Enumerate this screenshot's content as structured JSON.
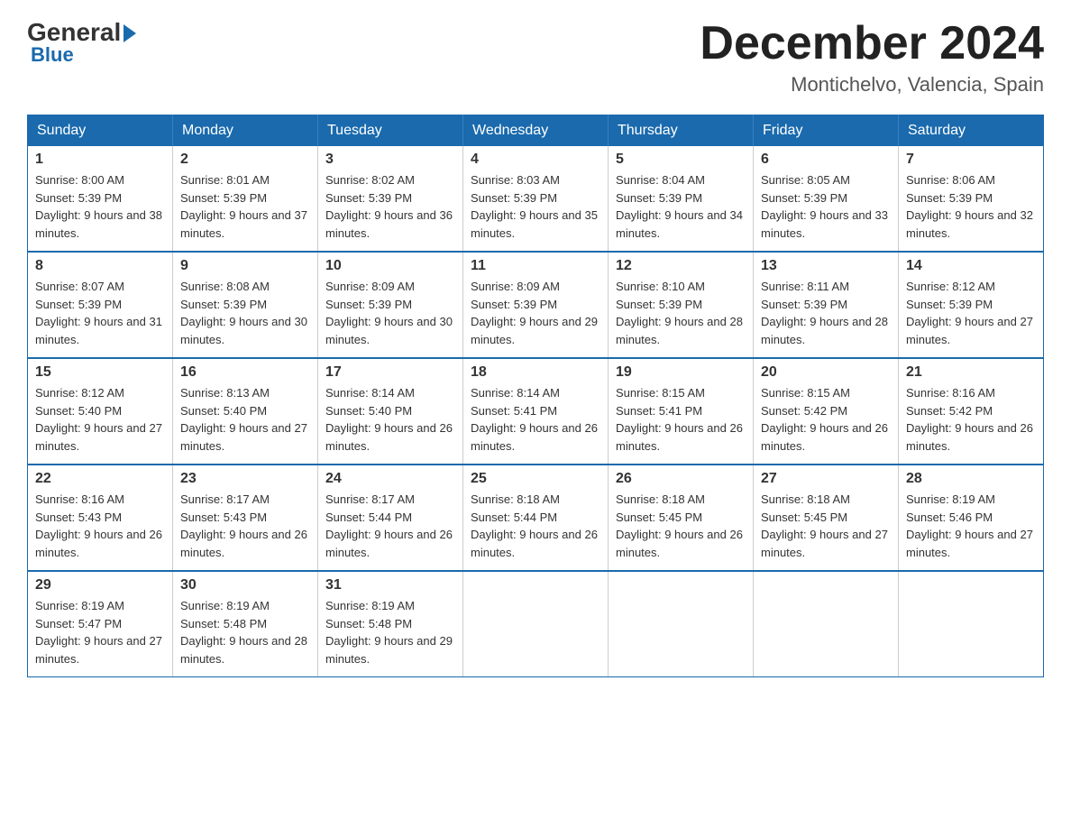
{
  "logo": {
    "general": "General",
    "blue": "Blue"
  },
  "title": {
    "month": "December 2024",
    "location": "Montichelvo, Valencia, Spain"
  },
  "weekdays": [
    "Sunday",
    "Monday",
    "Tuesday",
    "Wednesday",
    "Thursday",
    "Friday",
    "Saturday"
  ],
  "weeks": [
    [
      {
        "day": "1",
        "sunrise": "8:00 AM",
        "sunset": "5:39 PM",
        "daylight": "9 hours and 38 minutes."
      },
      {
        "day": "2",
        "sunrise": "8:01 AM",
        "sunset": "5:39 PM",
        "daylight": "9 hours and 37 minutes."
      },
      {
        "day": "3",
        "sunrise": "8:02 AM",
        "sunset": "5:39 PM",
        "daylight": "9 hours and 36 minutes."
      },
      {
        "day": "4",
        "sunrise": "8:03 AM",
        "sunset": "5:39 PM",
        "daylight": "9 hours and 35 minutes."
      },
      {
        "day": "5",
        "sunrise": "8:04 AM",
        "sunset": "5:39 PM",
        "daylight": "9 hours and 34 minutes."
      },
      {
        "day": "6",
        "sunrise": "8:05 AM",
        "sunset": "5:39 PM",
        "daylight": "9 hours and 33 minutes."
      },
      {
        "day": "7",
        "sunrise": "8:06 AM",
        "sunset": "5:39 PM",
        "daylight": "9 hours and 32 minutes."
      }
    ],
    [
      {
        "day": "8",
        "sunrise": "8:07 AM",
        "sunset": "5:39 PM",
        "daylight": "9 hours and 31 minutes."
      },
      {
        "day": "9",
        "sunrise": "8:08 AM",
        "sunset": "5:39 PM",
        "daylight": "9 hours and 30 minutes."
      },
      {
        "day": "10",
        "sunrise": "8:09 AM",
        "sunset": "5:39 PM",
        "daylight": "9 hours and 30 minutes."
      },
      {
        "day": "11",
        "sunrise": "8:09 AM",
        "sunset": "5:39 PM",
        "daylight": "9 hours and 29 minutes."
      },
      {
        "day": "12",
        "sunrise": "8:10 AM",
        "sunset": "5:39 PM",
        "daylight": "9 hours and 28 minutes."
      },
      {
        "day": "13",
        "sunrise": "8:11 AM",
        "sunset": "5:39 PM",
        "daylight": "9 hours and 28 minutes."
      },
      {
        "day": "14",
        "sunrise": "8:12 AM",
        "sunset": "5:39 PM",
        "daylight": "9 hours and 27 minutes."
      }
    ],
    [
      {
        "day": "15",
        "sunrise": "8:12 AM",
        "sunset": "5:40 PM",
        "daylight": "9 hours and 27 minutes."
      },
      {
        "day": "16",
        "sunrise": "8:13 AM",
        "sunset": "5:40 PM",
        "daylight": "9 hours and 27 minutes."
      },
      {
        "day": "17",
        "sunrise": "8:14 AM",
        "sunset": "5:40 PM",
        "daylight": "9 hours and 26 minutes."
      },
      {
        "day": "18",
        "sunrise": "8:14 AM",
        "sunset": "5:41 PM",
        "daylight": "9 hours and 26 minutes."
      },
      {
        "day": "19",
        "sunrise": "8:15 AM",
        "sunset": "5:41 PM",
        "daylight": "9 hours and 26 minutes."
      },
      {
        "day": "20",
        "sunrise": "8:15 AM",
        "sunset": "5:42 PM",
        "daylight": "9 hours and 26 minutes."
      },
      {
        "day": "21",
        "sunrise": "8:16 AM",
        "sunset": "5:42 PM",
        "daylight": "9 hours and 26 minutes."
      }
    ],
    [
      {
        "day": "22",
        "sunrise": "8:16 AM",
        "sunset": "5:43 PM",
        "daylight": "9 hours and 26 minutes."
      },
      {
        "day": "23",
        "sunrise": "8:17 AM",
        "sunset": "5:43 PM",
        "daylight": "9 hours and 26 minutes."
      },
      {
        "day": "24",
        "sunrise": "8:17 AM",
        "sunset": "5:44 PM",
        "daylight": "9 hours and 26 minutes."
      },
      {
        "day": "25",
        "sunrise": "8:18 AM",
        "sunset": "5:44 PM",
        "daylight": "9 hours and 26 minutes."
      },
      {
        "day": "26",
        "sunrise": "8:18 AM",
        "sunset": "5:45 PM",
        "daylight": "9 hours and 26 minutes."
      },
      {
        "day": "27",
        "sunrise": "8:18 AM",
        "sunset": "5:45 PM",
        "daylight": "9 hours and 27 minutes."
      },
      {
        "day": "28",
        "sunrise": "8:19 AM",
        "sunset": "5:46 PM",
        "daylight": "9 hours and 27 minutes."
      }
    ],
    [
      {
        "day": "29",
        "sunrise": "8:19 AM",
        "sunset": "5:47 PM",
        "daylight": "9 hours and 27 minutes."
      },
      {
        "day": "30",
        "sunrise": "8:19 AM",
        "sunset": "5:48 PM",
        "daylight": "9 hours and 28 minutes."
      },
      {
        "day": "31",
        "sunrise": "8:19 AM",
        "sunset": "5:48 PM",
        "daylight": "9 hours and 29 minutes."
      },
      null,
      null,
      null,
      null
    ]
  ]
}
